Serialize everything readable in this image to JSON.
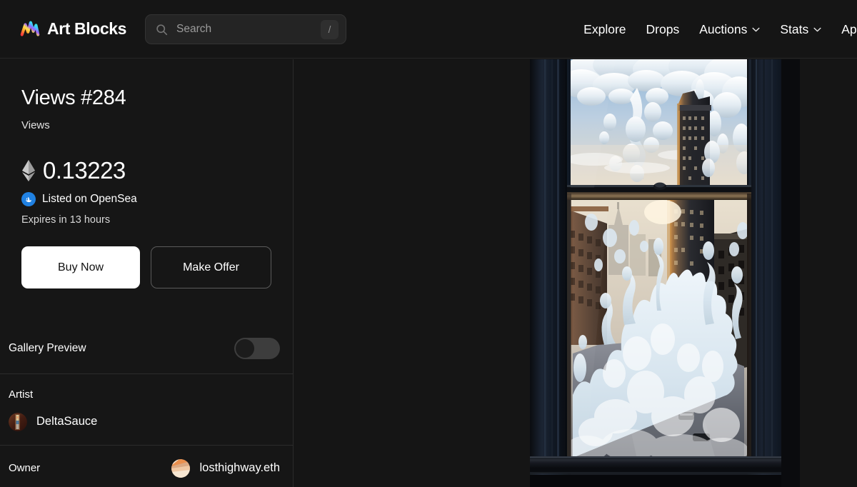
{
  "header": {
    "brand_name": "Art Blocks",
    "brand_icon": "artblocks-wave-logo",
    "search": {
      "placeholder": "Search",
      "value": "",
      "icon": "search-icon",
      "shortcut_key": "/"
    },
    "nav": [
      {
        "label": "Explore",
        "has_chevron": false
      },
      {
        "label": "Drops",
        "has_chevron": false
      },
      {
        "label": "Auctions",
        "has_chevron": true
      },
      {
        "label": "Stats",
        "has_chevron": true
      },
      {
        "label": "Apply",
        "has_chevron": false
      }
    ]
  },
  "token": {
    "title": "Views #284",
    "collection": "Views",
    "price": "0.13223",
    "currency_icon": "ethereum-icon",
    "marketplace": {
      "label": "Listed on OpenSea",
      "icon": "opensea-icon",
      "icon_color": "#2081E2"
    },
    "expiry": "Expires in 13 hours",
    "buy_label": "Buy Now",
    "offer_label": "Make Offer"
  },
  "gallery_preview": {
    "label": "Gallery Preview",
    "enabled": false
  },
  "artist": {
    "label": "Artist",
    "name": "DeltaSauce",
    "avatar": "artist-avatar"
  },
  "owner": {
    "label": "Owner",
    "name": "losthighway.eth",
    "avatar": "owner-avatar"
  },
  "artwork": {
    "alt": "Generative artwork: window frame looking out over a city street with billowing white cloud forms"
  },
  "colors": {
    "background": "#151515",
    "panel": "#161616",
    "divider": "#2c2c2c",
    "accent_white": "#ffffff",
    "opensea_blue": "#2081E2"
  }
}
